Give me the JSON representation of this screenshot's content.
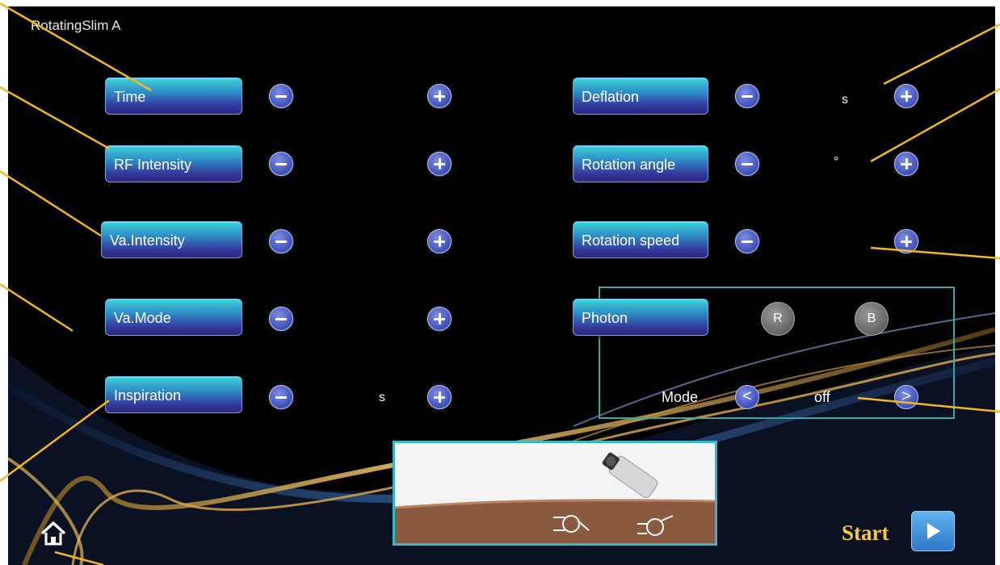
{
  "app_title": "RotatingSlim A",
  "left_params": [
    {
      "label": "Time",
      "unit": ""
    },
    {
      "label": "RF Intensity",
      "unit": ""
    },
    {
      "label": "Va.Intensity",
      "unit": ""
    },
    {
      "label": "Va.Mode",
      "unit": ""
    },
    {
      "label": "Inspiration",
      "unit": "s"
    }
  ],
  "right_params": [
    {
      "label": "Deflation",
      "unit": "s"
    },
    {
      "label": "Rotation angle",
      "unit": "°"
    },
    {
      "label": "Rotation speed",
      "unit": ""
    }
  ],
  "photon": {
    "label": "Photon",
    "r_label": "R",
    "b_label": "B",
    "mode_label": "Mode",
    "mode_value": "off"
  },
  "start_label": "Start",
  "icons": {
    "minus": "minus-icon",
    "plus": "plus-icon",
    "home": "home-icon",
    "play": "play-icon",
    "prev": "chevron-left-icon",
    "next": "chevron-right-icon"
  },
  "colors": {
    "button_gradient_top": "#3fd3d6",
    "button_gradient_bottom": "#2a2680",
    "start_text": "#f5c84a",
    "callout_line": "#f5b81c",
    "photon_border": "#3aa6a8"
  }
}
